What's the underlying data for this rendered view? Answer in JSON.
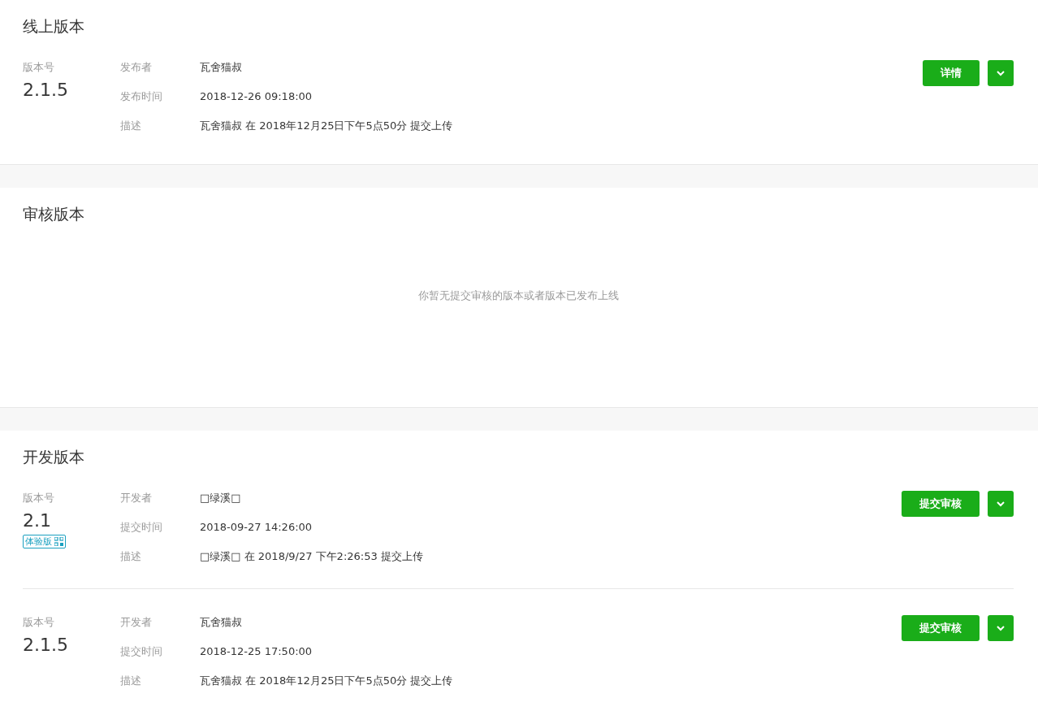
{
  "sections": [
    {
      "kind": "versions",
      "title": "线上版本",
      "versions": [
        {
          "version_label": "版本号",
          "version": "2.1.5",
          "fields": [
            {
              "label": "发布者",
              "value": "瓦舍猫叔"
            },
            {
              "label": "发布时间",
              "value": "2018-12-26 09:18:00"
            },
            {
              "label": "描述",
              "value": "瓦舍猫叔 在 2018年12月25日下午5点50分 提交上传"
            }
          ],
          "button": "详情"
        }
      ]
    },
    {
      "kind": "empty",
      "title": "审核版本",
      "message": "你暂无提交审核的版本或者版本已发布上线"
    },
    {
      "kind": "versions",
      "title": "开发版本",
      "versions": [
        {
          "version_label": "版本号",
          "version": "2.1",
          "tag": "体验版",
          "fields": [
            {
              "label": "开发者",
              "value": "□绿溪□"
            },
            {
              "label": "提交时间",
              "value": "2018-09-27 14:26:00"
            },
            {
              "label": "描述",
              "value": "□绿溪□ 在 2018/9/27 下午2:26:53 提交上传"
            }
          ],
          "button": "提交审核"
        },
        {
          "version_label": "版本号",
          "version": "2.1.5",
          "fields": [
            {
              "label": "开发者",
              "value": "瓦舍猫叔"
            },
            {
              "label": "提交时间",
              "value": "2018-12-25 17:50:00"
            },
            {
              "label": "描述",
              "value": "瓦舍猫叔 在 2018年12月25日下午5点50分 提交上传"
            }
          ],
          "button": "提交审核"
        }
      ]
    }
  ]
}
